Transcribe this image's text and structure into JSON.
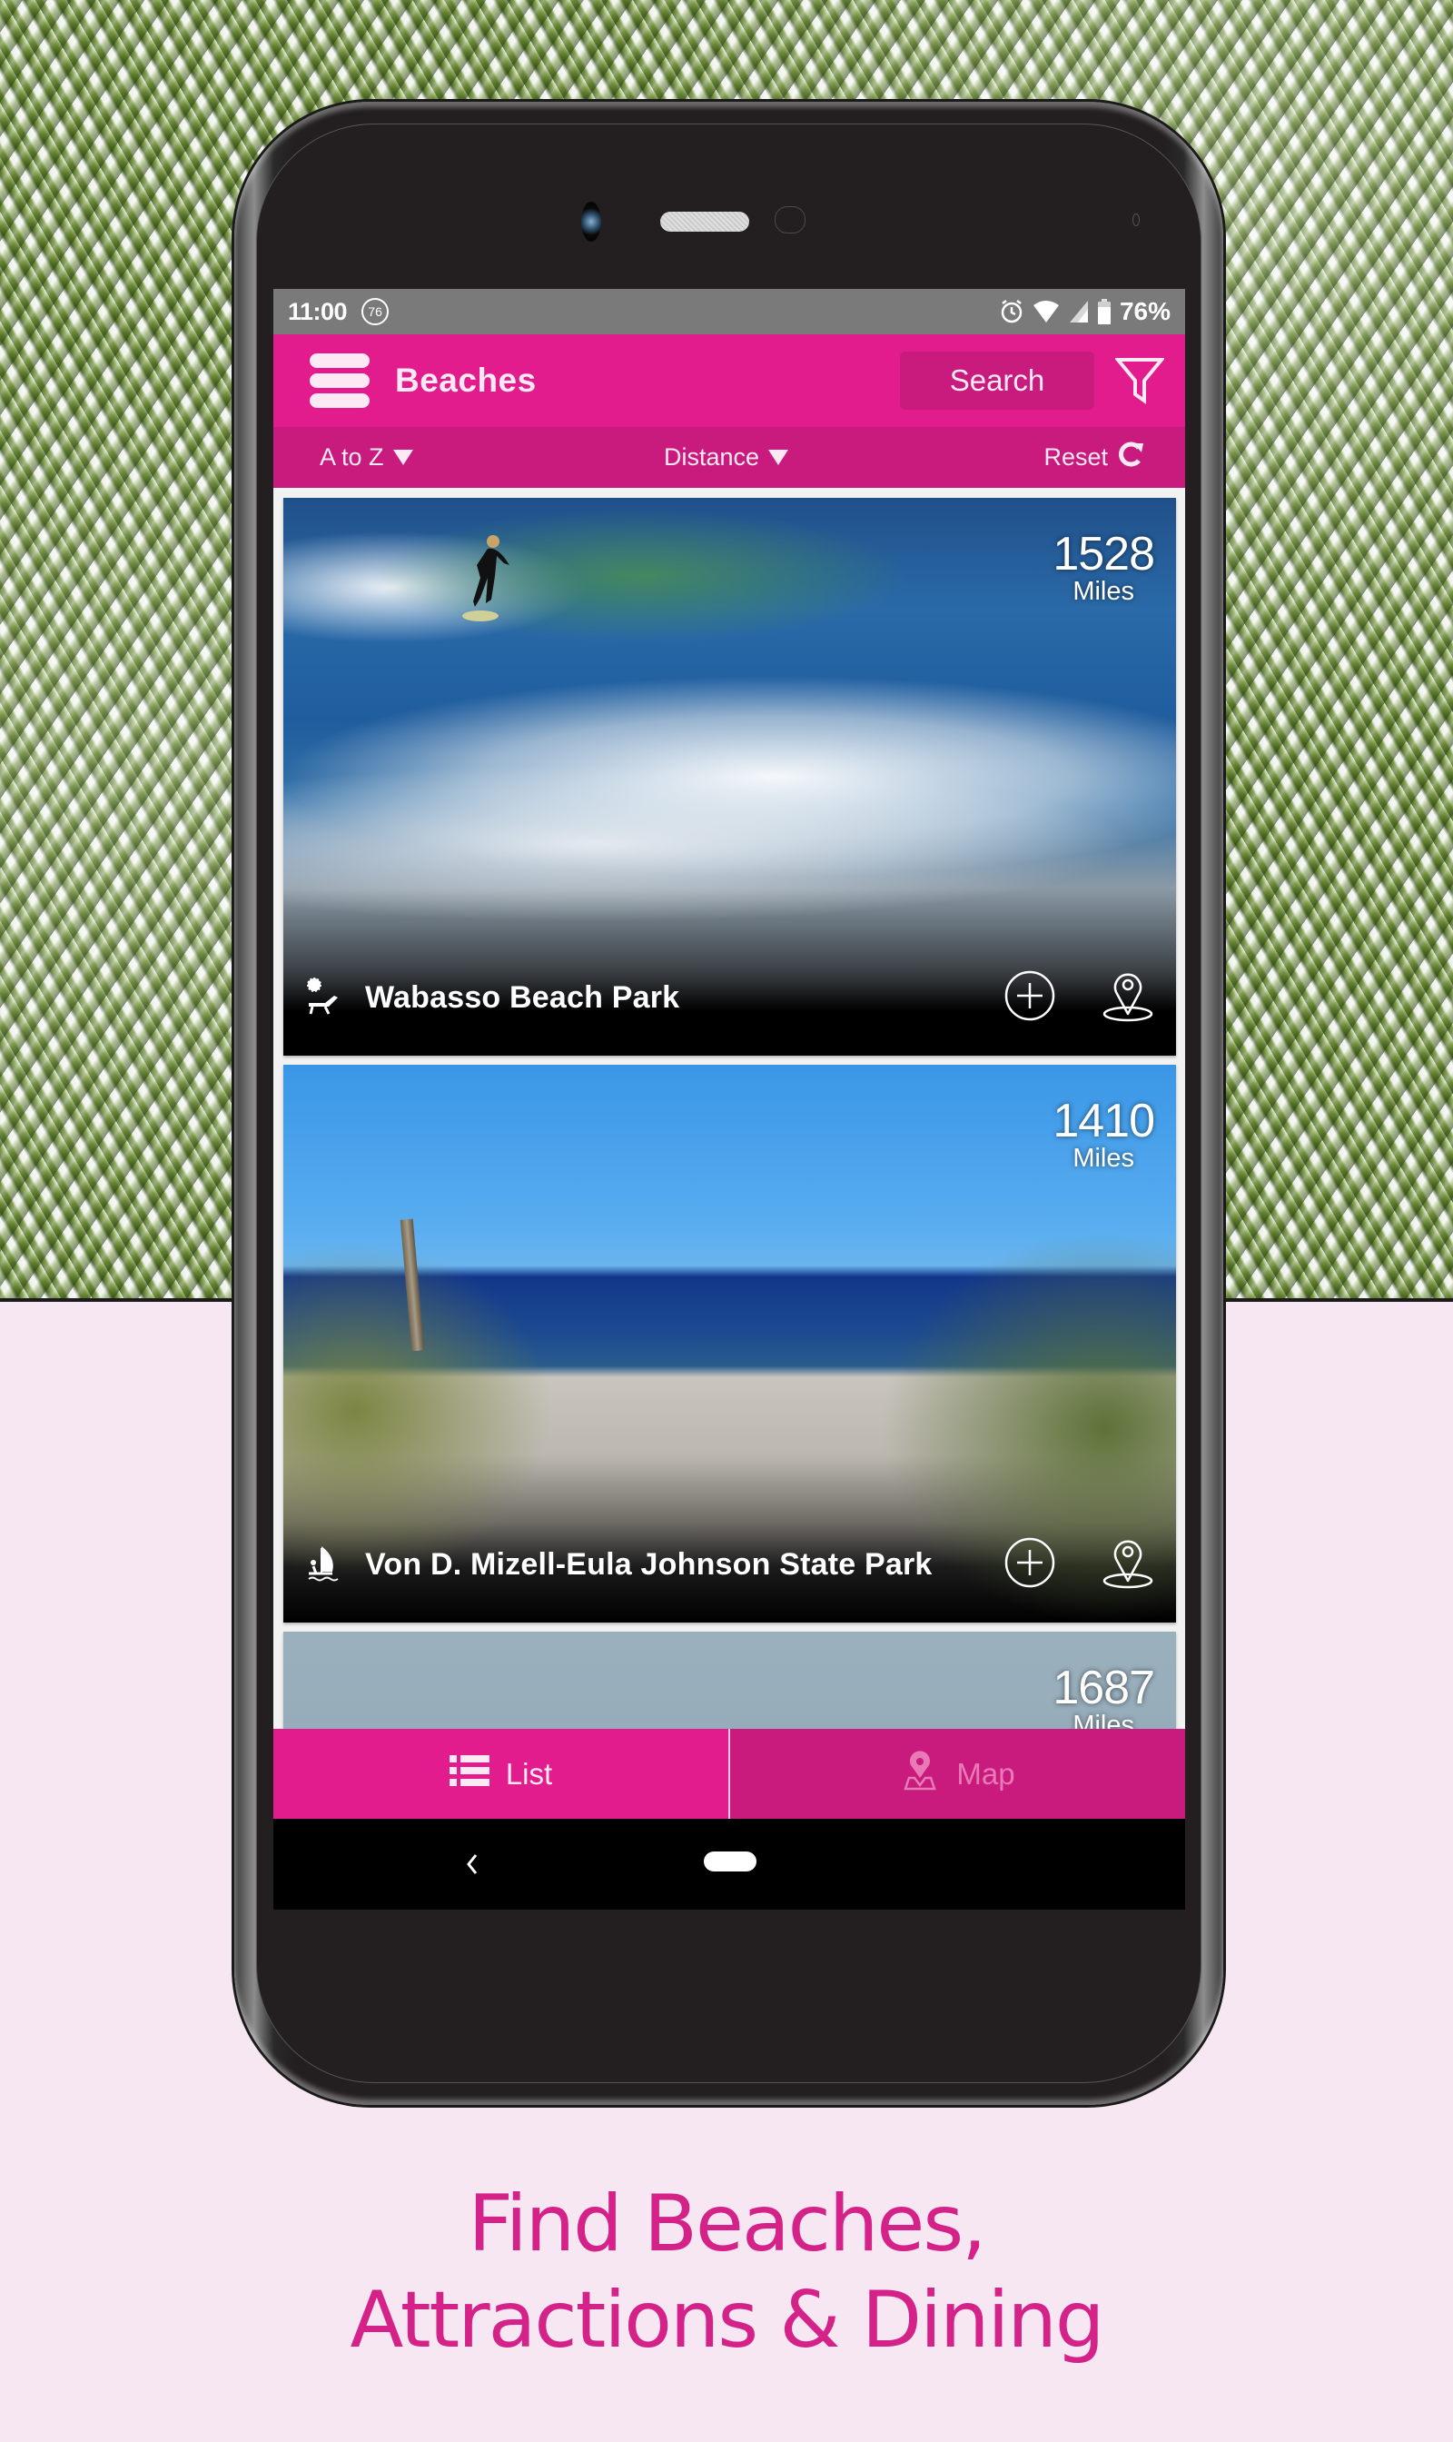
{
  "status_bar": {
    "time": "11:00",
    "notification_badge": "76",
    "battery_percent": "76%",
    "icons": [
      "alarm-icon",
      "wifi-icon",
      "signal-icon",
      "battery-icon"
    ]
  },
  "app_bar": {
    "title": "Beaches",
    "search_label": "Search",
    "menu_icon": "hamburger-menu-icon",
    "filter_icon": "filter-funnel-icon"
  },
  "sort_bar": {
    "alpha_label": "A to Z",
    "distance_label": "Distance",
    "reset_label": "Reset"
  },
  "listings": [
    {
      "name": "Wabasso Beach Park",
      "distance": "1528",
      "unit": "Miles",
      "category_icon": "beach-lounger-icon"
    },
    {
      "name": "Von D. Mizell-Eula Johnson State Park",
      "distance": "1410",
      "unit": "Miles",
      "category_icon": "windsurf-icon"
    },
    {
      "name": "",
      "distance": "1687",
      "unit": "Miles",
      "category_icon": ""
    }
  ],
  "bottom_tabs": {
    "list_label": "List",
    "map_label": "Map",
    "active": "List"
  },
  "tagline": {
    "line1": "Find Beaches,",
    "line2": "Attractions & Dining"
  },
  "colors": {
    "brand_pink": "#e21c8c",
    "brand_pink_dark": "#c91a7d",
    "tagline_pink": "#d42289",
    "page_background": "#f7e7f2"
  }
}
